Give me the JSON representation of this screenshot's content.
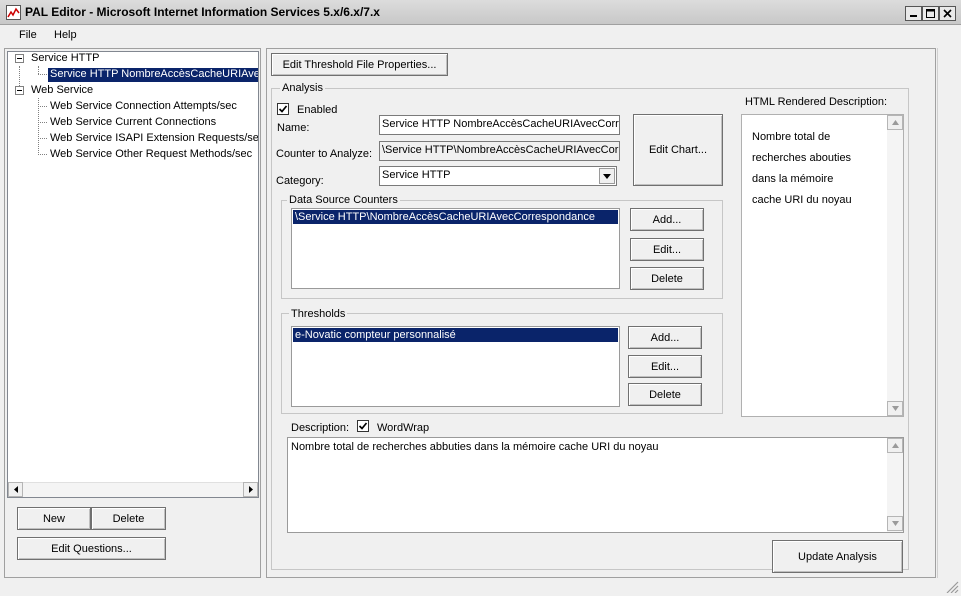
{
  "window": {
    "title": "PAL Editor - Microsoft Internet Information Services 5.x/6.x/7.x"
  },
  "menu": {
    "file": "File",
    "help": "Help"
  },
  "tree": {
    "groups": [
      {
        "label": "Service HTTP",
        "children": [
          "Service HTTP NombreAccèsCacheURIAvec"
        ]
      },
      {
        "label": "Web Service",
        "children": [
          "Web Service Connection Attempts/sec",
          "Web Service Current Connections",
          "Web Service ISAPI Extension Requests/sec",
          "Web Service Other Request Methods/sec"
        ]
      }
    ],
    "selected": "Service HTTP NombreAccèsCacheURIAvec"
  },
  "left_buttons": {
    "new": "New",
    "delete": "Delete",
    "edit_questions": "Edit Questions..."
  },
  "edit_threshold_file": "Edit Threshold File Properties...",
  "analysis": {
    "group_label": "Analysis",
    "enabled_label": "Enabled",
    "name_label": "Name:",
    "name_value": "Service HTTP NombreAccèsCacheURIAvecCorre",
    "counter_label": "Counter to Analyze:",
    "counter_value": "\\Service HTTP\\NombreAccèsCacheURIAvecCor",
    "category_label": "Category:",
    "category_value": "Service HTTP",
    "edit_chart": "Edit Chart..."
  },
  "data_source": {
    "label": "Data Source Counters",
    "items": [
      "\\Service HTTP\\NombreAccèsCacheURIAvecCorrespondance"
    ],
    "add": "Add...",
    "edit": "Edit...",
    "delete": "Delete"
  },
  "thresholds": {
    "label": "Thresholds",
    "items": [
      "e-Novatic compteur personnalisé"
    ],
    "add": "Add...",
    "edit": "Edit...",
    "delete": "Delete"
  },
  "html_rendered": {
    "label": "HTML Rendered Description:",
    "lines": [
      "Nombre total de",
      "recherches abouties",
      "dans la mémoire",
      "cache URI du noyau"
    ]
  },
  "description": {
    "label": "Description:",
    "wordwrap_label": "WordWrap",
    "text": "Nombre total de recherches abbuties dans la mémoire cache URI du noyau"
  },
  "update_analysis": "Update Analysis"
}
